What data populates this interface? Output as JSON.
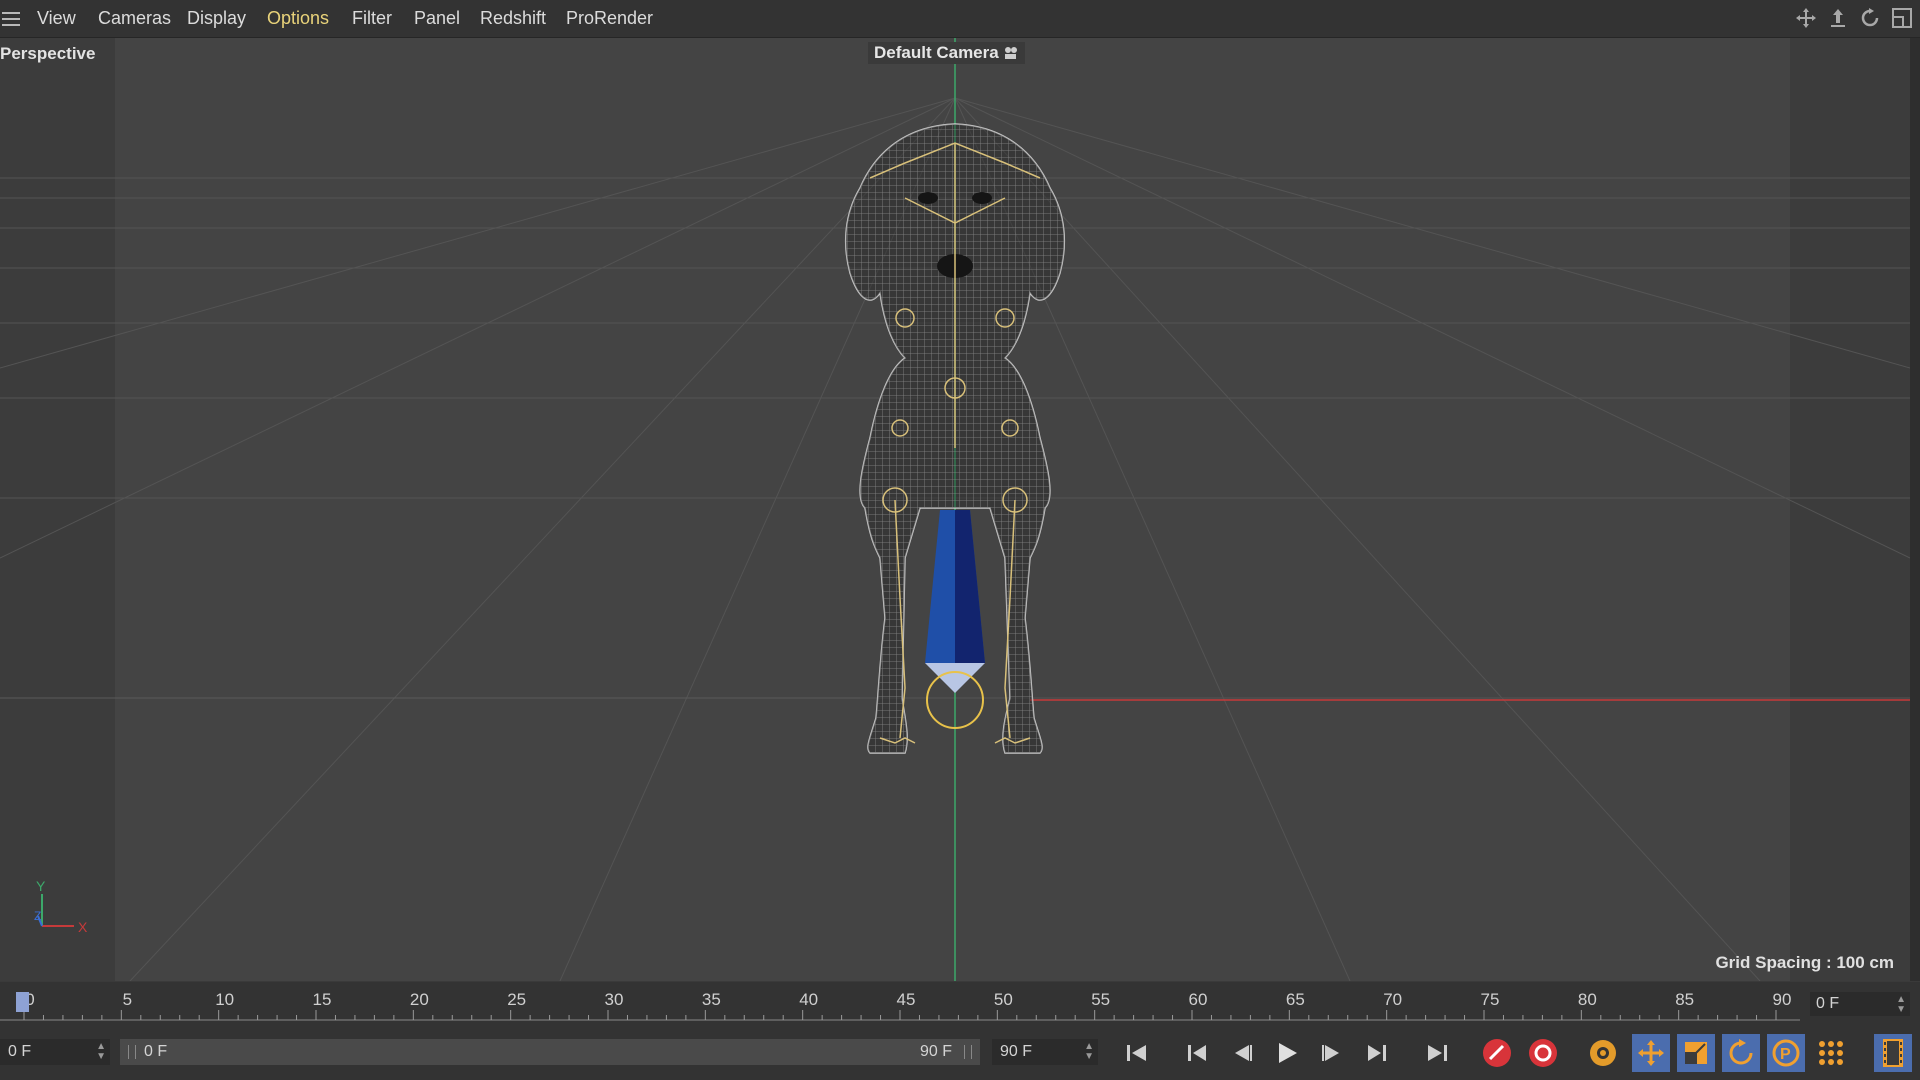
{
  "menubar": {
    "items": [
      {
        "label": "View",
        "active": false
      },
      {
        "label": "Cameras",
        "active": false
      },
      {
        "label": "Display",
        "active": false
      },
      {
        "label": "Options",
        "active": true
      },
      {
        "label": "Filter",
        "active": false
      },
      {
        "label": "Panel",
        "active": false
      },
      {
        "label": "Redshift",
        "active": false
      },
      {
        "label": "ProRender",
        "active": false
      }
    ],
    "nav_icons": [
      "move-view-icon",
      "dolly-view-icon",
      "rotate-view-icon",
      "maximize-view-icon"
    ]
  },
  "viewport": {
    "view_name": "Perspective",
    "camera_label": "Default Camera",
    "grid_spacing": "Grid Spacing : 100 cm",
    "axis_labels": {
      "y": "Y",
      "z": "Z",
      "x": "X"
    },
    "colors": {
      "x_axis": "#c63a3a",
      "y_axis": "#3ca86a",
      "wireframe": "#d9d9d9",
      "joints": "#d8c07a",
      "bone": "#1f4fa8"
    }
  },
  "timeline": {
    "ticks": [
      "0",
      "5",
      "10",
      "15",
      "20",
      "25",
      "30",
      "35",
      "40",
      "45",
      "50",
      "55",
      "60",
      "65",
      "70",
      "75",
      "80",
      "85",
      "90"
    ],
    "current_frame": "0 F"
  },
  "transport": {
    "start_field": "0 F",
    "range_start": "0 F",
    "range_end": "90 F",
    "end_field": "90 F",
    "buttons": [
      "go-to-start-icon",
      "previous-key-icon",
      "previous-frame-icon",
      "play-icon",
      "next-frame-icon",
      "next-key-icon",
      "go-to-end-icon",
      "record-active-objects-icon",
      "autokeying-icon",
      "keyframe-selection-icon",
      "record-position-icon",
      "record-scale-icon",
      "record-rotation-icon",
      "record-parameter-icon",
      "record-point-level-icon",
      "timeline-window-icon"
    ]
  }
}
